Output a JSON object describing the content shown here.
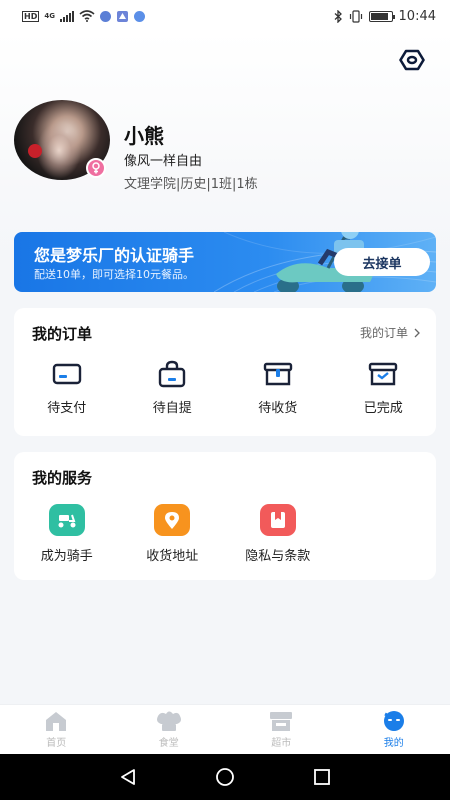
{
  "status_bar": {
    "hd_label": "HD",
    "network_label": "4G",
    "time": "10:44",
    "battery_level": 0.85
  },
  "header": {
    "settings_icon": "settings-hexagon-icon"
  },
  "profile": {
    "nickname": "小熊",
    "motto": "像风一样自由",
    "school_info": "文理学院|历史|1班|1栋",
    "gender_icon": "female-icon"
  },
  "rider_banner": {
    "title": "您是梦乐厂的认证骑手",
    "subtitle": "配送10单，即可选择10元餐品。",
    "button_label": "去接单"
  },
  "orders": {
    "title": "我的订单",
    "link_label": "我的订单",
    "items": [
      {
        "label": "待支付",
        "icon": "wallet-card-icon"
      },
      {
        "label": "待自提",
        "icon": "shopping-bag-icon"
      },
      {
        "label": "待收货",
        "icon": "package-box-icon"
      },
      {
        "label": "已完成",
        "icon": "completed-box-icon"
      }
    ]
  },
  "services": {
    "title": "我的服务",
    "items": [
      {
        "label": "成为骑手",
        "icon": "scooter-icon",
        "color": "#2fbfa2"
      },
      {
        "label": "收货地址",
        "icon": "location-pin-icon",
        "color": "#f7931e"
      },
      {
        "label": "隐私与条款",
        "icon": "bookmark-icon",
        "color": "#f25a5a"
      }
    ]
  },
  "tabbar": {
    "items": [
      {
        "label": "首页",
        "icon": "home-icon"
      },
      {
        "label": "食堂",
        "icon": "chef-hat-icon"
      },
      {
        "label": "超市",
        "icon": "store-icon"
      },
      {
        "label": "我的",
        "icon": "profile-chat-icon",
        "active": true
      }
    ]
  },
  "colors": {
    "accent": "#1b7ee8",
    "banner_blue": "#1976e6",
    "background": "#f4f6f9"
  }
}
